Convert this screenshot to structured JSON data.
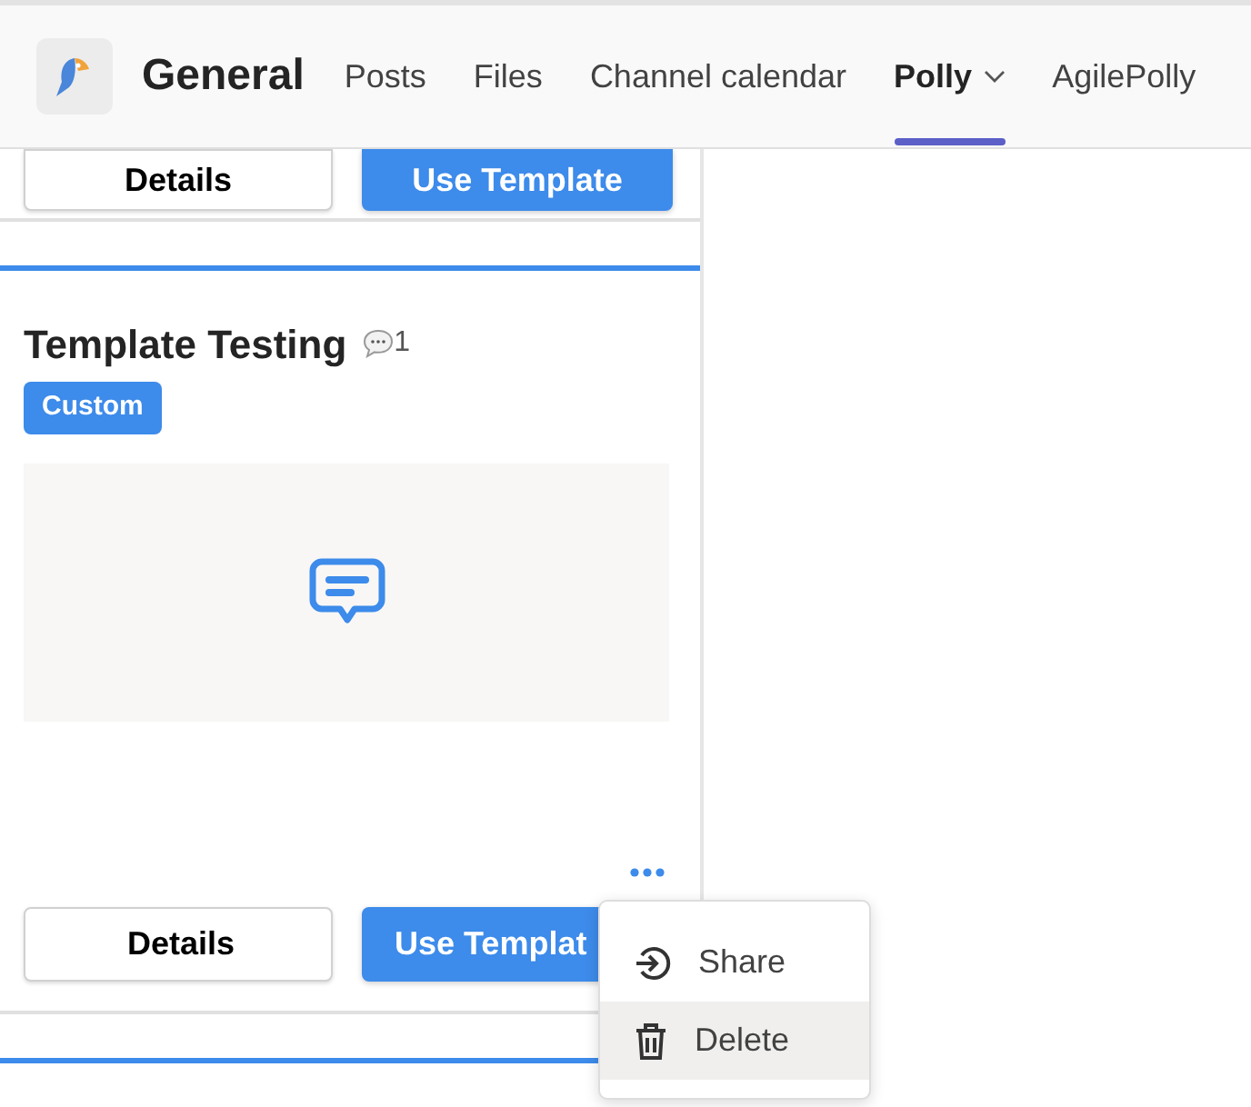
{
  "header": {
    "title": "General",
    "tabs": [
      {
        "label": "Posts",
        "selected": false,
        "dropdown": false
      },
      {
        "label": "Files",
        "selected": false,
        "dropdown": false
      },
      {
        "label": "Channel calendar",
        "selected": false,
        "dropdown": false
      },
      {
        "label": "Polly",
        "selected": true,
        "dropdown": true
      },
      {
        "label": "AgilePolly",
        "selected": false,
        "dropdown": false
      }
    ]
  },
  "cards": [
    {
      "partial": true,
      "buttons": [
        "Details",
        "Use Template"
      ]
    },
    {
      "partial": false,
      "title": "Template Testing",
      "comment_count": "1",
      "tag": "Custom",
      "buttons": [
        "Details",
        "Use Templat"
      ],
      "menu": [
        {
          "kind": "share",
          "label": "Share",
          "selected": false
        },
        {
          "kind": "delete",
          "label": "Delete",
          "selected": true
        }
      ]
    }
  ]
}
